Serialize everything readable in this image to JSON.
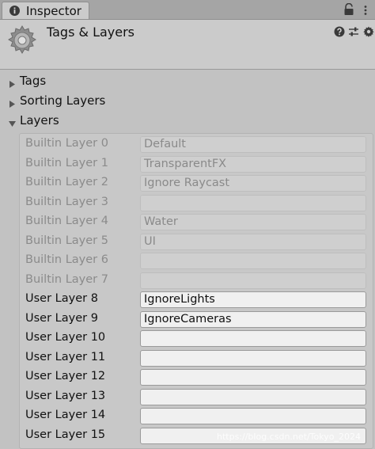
{
  "tab": {
    "label": "Inspector"
  },
  "header": {
    "title": "Tags & Layers"
  },
  "foldouts": {
    "tags": "Tags",
    "sorting_layers": "Sorting Layers",
    "layers": "Layers"
  },
  "layers": [
    {
      "label": "Builtin Layer 0",
      "value": "Default",
      "builtin": true
    },
    {
      "label": "Builtin Layer 1",
      "value": "TransparentFX",
      "builtin": true
    },
    {
      "label": "Builtin Layer 2",
      "value": "Ignore Raycast",
      "builtin": true
    },
    {
      "label": "Builtin Layer 3",
      "value": "",
      "builtin": true
    },
    {
      "label": "Builtin Layer 4",
      "value": "Water",
      "builtin": true
    },
    {
      "label": "Builtin Layer 5",
      "value": "UI",
      "builtin": true
    },
    {
      "label": "Builtin Layer 6",
      "value": "",
      "builtin": true
    },
    {
      "label": "Builtin Layer 7",
      "value": "",
      "builtin": true
    },
    {
      "label": "User Layer 8",
      "value": "IgnoreLights",
      "builtin": false
    },
    {
      "label": "User Layer 9",
      "value": "IgnoreCameras",
      "builtin": false
    },
    {
      "label": "User Layer 10",
      "value": "",
      "builtin": false
    },
    {
      "label": "User Layer 11",
      "value": "",
      "builtin": false
    },
    {
      "label": "User Layer 12",
      "value": "",
      "builtin": false
    },
    {
      "label": "User Layer 13",
      "value": "",
      "builtin": false
    },
    {
      "label": "User Layer 14",
      "value": "",
      "builtin": false
    },
    {
      "label": "User Layer 15",
      "value": "",
      "builtin": false
    }
  ],
  "watermark": "https://blog.csdn.net/Tokyo_2024",
  "icons": {
    "tab": "info-icon",
    "lock": "lock-icon",
    "menu": "kebab-menu-icon",
    "header": "gear-icon",
    "help": "help-icon",
    "presets": "presets-icon",
    "settings": "settings-icon"
  },
  "colors": {
    "background": "#c2c2c2",
    "tab_bar": "#a5a5a5",
    "user_field": "#f0f0f0",
    "builtin_text": "#8b8b8b"
  }
}
